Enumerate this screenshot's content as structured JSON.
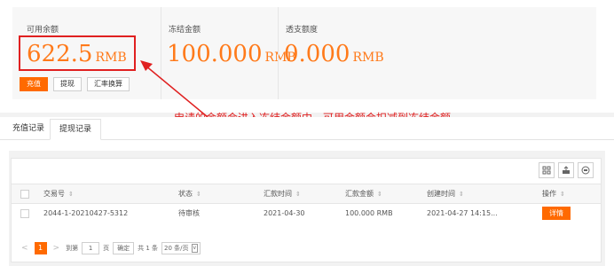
{
  "balances": [
    {
      "label": "可用余额",
      "amount": "622.5",
      "unit": "RMB"
    },
    {
      "label": "冻结金额",
      "amount": "100.000",
      "unit": "RMB"
    },
    {
      "label": "透支额度",
      "amount": "0.000",
      "unit": "RMB"
    }
  ],
  "actions": {
    "recharge": "充值",
    "withdraw": "提现",
    "exchange": "汇率换算"
  },
  "annotation": "申请的金额会进入冻结金额中，可用金额会扣减到冻结金额",
  "tabs": [
    {
      "label": "充值记录"
    },
    {
      "label": "提现记录",
      "active": true
    }
  ],
  "table": {
    "headers": [
      "交易号",
      "状态",
      "汇款时间",
      "汇款金额",
      "创建时间",
      "操作"
    ],
    "rows": [
      {
        "trade_no": "2044-1-20210427-5312",
        "status": "待审核",
        "remit_time": "2021-04-30",
        "amount": "100.000 RMB",
        "created": "2021-04-27 14:15...",
        "action": "详情"
      }
    ]
  },
  "pagination": {
    "prev": "<",
    "current": "1",
    "next": ">",
    "goto_label": "到第",
    "goto_value": "1",
    "page_unit": "页",
    "confirm": "确定",
    "total": "共 1 条",
    "page_size": "20 条/页",
    "caret": "v"
  },
  "icons": [
    "columns-icon",
    "export-icon",
    "print-icon",
    "sort-icon"
  ],
  "colors": {
    "accent": "#ff6a00",
    "annotation": "#e02020",
    "amount": "#ff7a1a"
  }
}
